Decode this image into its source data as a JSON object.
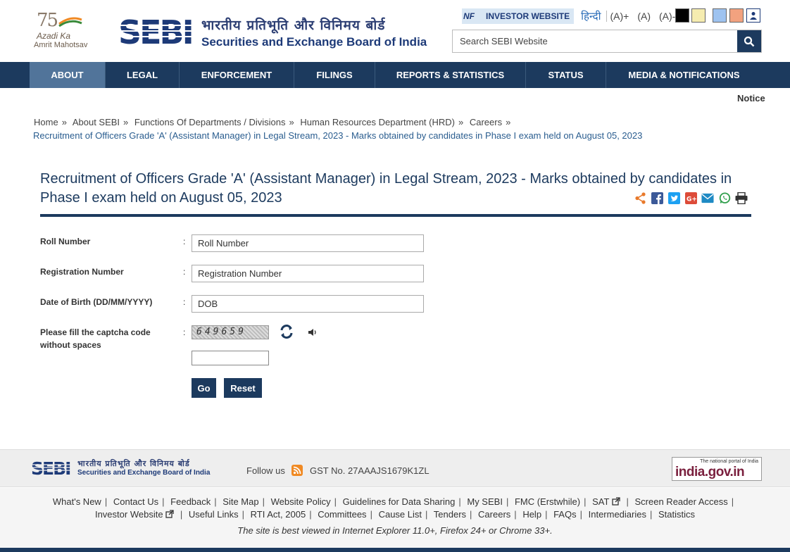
{
  "brand": {
    "azadi_number": "75",
    "azadi_line1": "Azadi Ka",
    "azadi_line2": "Amrit Mahotsav",
    "logo_text": "SEBI",
    "hindi_name": "भारतीय प्रतिभूति और विनिमय बोर्ड",
    "english_name": "Securities and Exchange Board of India"
  },
  "topbar": {
    "investor_prefix": "NF",
    "investor_label": "INVESTOR WEBSITE",
    "hindi_link": "हिन्दी",
    "font_plus": "(A)+",
    "font_normal": "(A)",
    "font_minus": "(A)-",
    "search_placeholder": "Search SEBI Website"
  },
  "nav": {
    "items": [
      {
        "label": "ABOUT"
      },
      {
        "label": "LEGAL"
      },
      {
        "label": "ENFORCEMENT"
      },
      {
        "label": "FILINGS"
      },
      {
        "label": "REPORTS & STATISTICS"
      },
      {
        "label": "STATUS"
      },
      {
        "label": "MEDIA & NOTIFICATIONS"
      }
    ]
  },
  "ticker": "Notice",
  "breadcrumb": {
    "items": [
      "Home",
      "About SEBI",
      "Functions Of Departments / Divisions",
      "Human Resources Department (HRD)",
      "Careers"
    ],
    "sep": "»",
    "current": "Recruitment of Officers Grade 'A' (Assistant Manager) in Legal Stream, 2023 - Marks obtained by candidates in Phase I exam held on August 05, 2023"
  },
  "page": {
    "title": "Recruitment of Officers Grade 'A' (Assistant Manager) in Legal Stream, 2023 - Marks obtained by candidates in Phase I exam held on August 05, 2023"
  },
  "form": {
    "roll_label": "Roll Number",
    "roll_placeholder": "Roll Number",
    "reg_label": "Registration Number",
    "reg_placeholder": "Registration Number",
    "dob_label": "Date of Birth (DD/MM/YYYY)",
    "dob_placeholder": "DOB",
    "captcha_label": "Please fill the captcha code without spaces",
    "captcha_code": "649659",
    "colon": ":",
    "go_label": "Go",
    "reset_label": "Reset"
  },
  "footer": {
    "hindi_name": "भारतीय प्रतिभूति और विनिमय बोर्ड",
    "english_name": "Securities and Exchange Board of India",
    "follow_us": "Follow us",
    "gst": "GST No. 27AAAJS1679K1ZL",
    "india_gov_small": "The national portal of India",
    "india_gov": "india.gov.in",
    "links_row1": [
      "What's New",
      "Contact Us",
      "Feedback",
      "Site Map",
      "Website Policy",
      "Guidelines for Data Sharing",
      "My SEBI",
      "FMC (Erstwhile)",
      "SAT",
      "Screen Reader Access"
    ],
    "links_row2": [
      "Investor Website",
      "Useful Links",
      "RTI Act, 2005",
      "Committees",
      "Cause List",
      "Tenders",
      "Careers",
      "Help",
      "FAQs",
      "Intermediaries",
      "Statistics"
    ],
    "link_sep": "|",
    "best_viewed": "The site is best viewed in Internet Explorer 11.0+, Firefox 24+ or Chrome 33+."
  },
  "colors": {
    "primary": "#1c3a5e",
    "nav_active": "#51749a",
    "link": "#2a5d8f"
  }
}
